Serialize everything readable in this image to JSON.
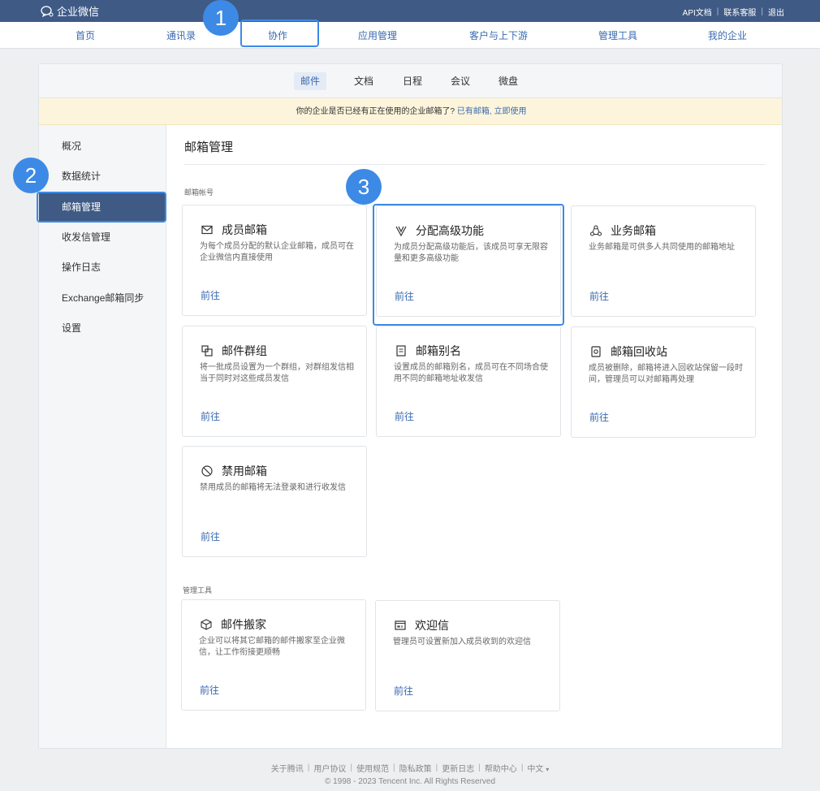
{
  "topbar": {
    "app_name": "企业微信",
    "links": [
      "API文档",
      "联系客服",
      "退出"
    ]
  },
  "main_nav": [
    "首页",
    "通讯录",
    "协作",
    "应用管理",
    "客户与上下游",
    "管理工具",
    "我的企业"
  ],
  "sub_nav": [
    "邮件",
    "文档",
    "日程",
    "会议",
    "微盘"
  ],
  "notice": {
    "text": "你的企业是否已经有正在使用的企业邮箱了?",
    "link": "已有邮箱, 立即使用"
  },
  "sidebar": [
    "概况",
    "数据统计",
    "邮箱管理",
    "收发信管理",
    "操作日志",
    "Exchange邮箱同步",
    "设置"
  ],
  "page_title": "邮箱管理",
  "sections": {
    "accounts": "邮箱帐号",
    "tools": "管理工具"
  },
  "cards": [
    {
      "title": "成员邮箱",
      "icon": "mail-icon",
      "desc": "为每个成员分配的默认企业邮箱，成员可在企业微信内直接使用",
      "link": "前往"
    },
    {
      "title": "分配高级功能",
      "icon": "premium-v-icon",
      "desc": "为成员分配高级功能后，该成员可享无限容量和更多高级功能",
      "link": "前往"
    },
    {
      "title": "业务邮箱",
      "icon": "shared-mailbox-icon",
      "desc": "业务邮箱是可供多人共同使用的邮箱地址",
      "link": "前往"
    },
    {
      "title": "邮件群组",
      "icon": "group-icon",
      "desc": "将一批成员设置为一个群组，对群组发信相当于同时对这些成员发信",
      "link": "前往"
    },
    {
      "title": "邮箱别名",
      "icon": "alias-icon",
      "desc": "设置成员的邮箱别名，成员可在不同场合使用不同的邮箱地址收发信",
      "link": "前往"
    },
    {
      "title": "邮箱回收站",
      "icon": "recycle-icon",
      "desc": "成员被删除，邮箱将进入回收站保留一段时间，管理员可以对邮箱再处理",
      "link": "前往"
    },
    {
      "title": "禁用邮箱",
      "icon": "disabled-icon",
      "desc": "禁用成员的邮箱将无法登录和进行收发信",
      "link": "前往"
    }
  ],
  "tool_cards": [
    {
      "title": "邮件搬家",
      "icon": "cube-icon",
      "desc": "企业可以将其它邮箱的邮件搬家至企业微信，让工作衔接更顺畅",
      "link": "前往"
    },
    {
      "title": "欢迎信",
      "icon": "welcome-icon",
      "desc": "管理员可设置新加入成员收到的欢迎信",
      "link": "前往"
    }
  ],
  "badges": [
    "1",
    "2",
    "3"
  ],
  "footer": {
    "links": [
      "关于腾讯",
      "用户协议",
      "使用规范",
      "隐私政策",
      "更新日志",
      "帮助中心"
    ],
    "lang": "中文",
    "copyright": "© 1998 - 2023 Tencent Inc. All Rights Reserved"
  },
  "colors": {
    "topbar": "#3f5a85",
    "accent": "#3a6ab0",
    "highlight": "#3c8ae6",
    "notice_bg": "#fcf5dc"
  }
}
